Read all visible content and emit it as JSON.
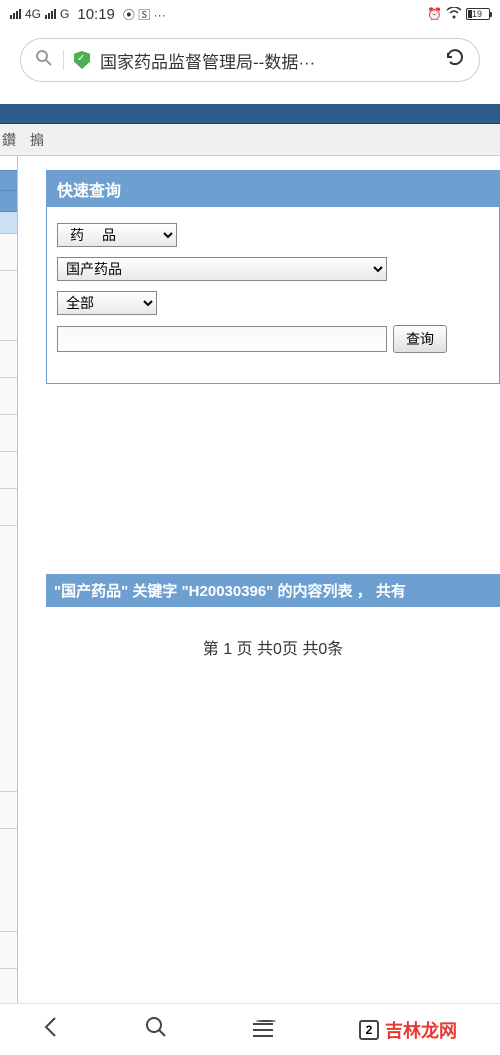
{
  "status": {
    "network": "4G",
    "signal_sub": "G",
    "time": "10:19",
    "icons_mid": "⦿ 🅂 ···",
    "alarm": "⏰",
    "battery_pct": "19"
  },
  "browser": {
    "title": "国家药品监督管理局--数据···"
  },
  "breadcrumb": {
    "item1": "鑽",
    "item2": "搧"
  },
  "panel": {
    "title": "快速查询",
    "select_type": "药品",
    "select_category": "国产药品",
    "select_scope": "全部",
    "input_value": "",
    "btn_search": "查询"
  },
  "results": {
    "header": "\"国产药品\" 关键字 \"H20030396\" 的内容列表 ， 共有",
    "pagination": "第 1 页 共0页 共0条"
  },
  "bottomnav": {
    "tab_count": "2",
    "brand": "吉林龙网"
  }
}
